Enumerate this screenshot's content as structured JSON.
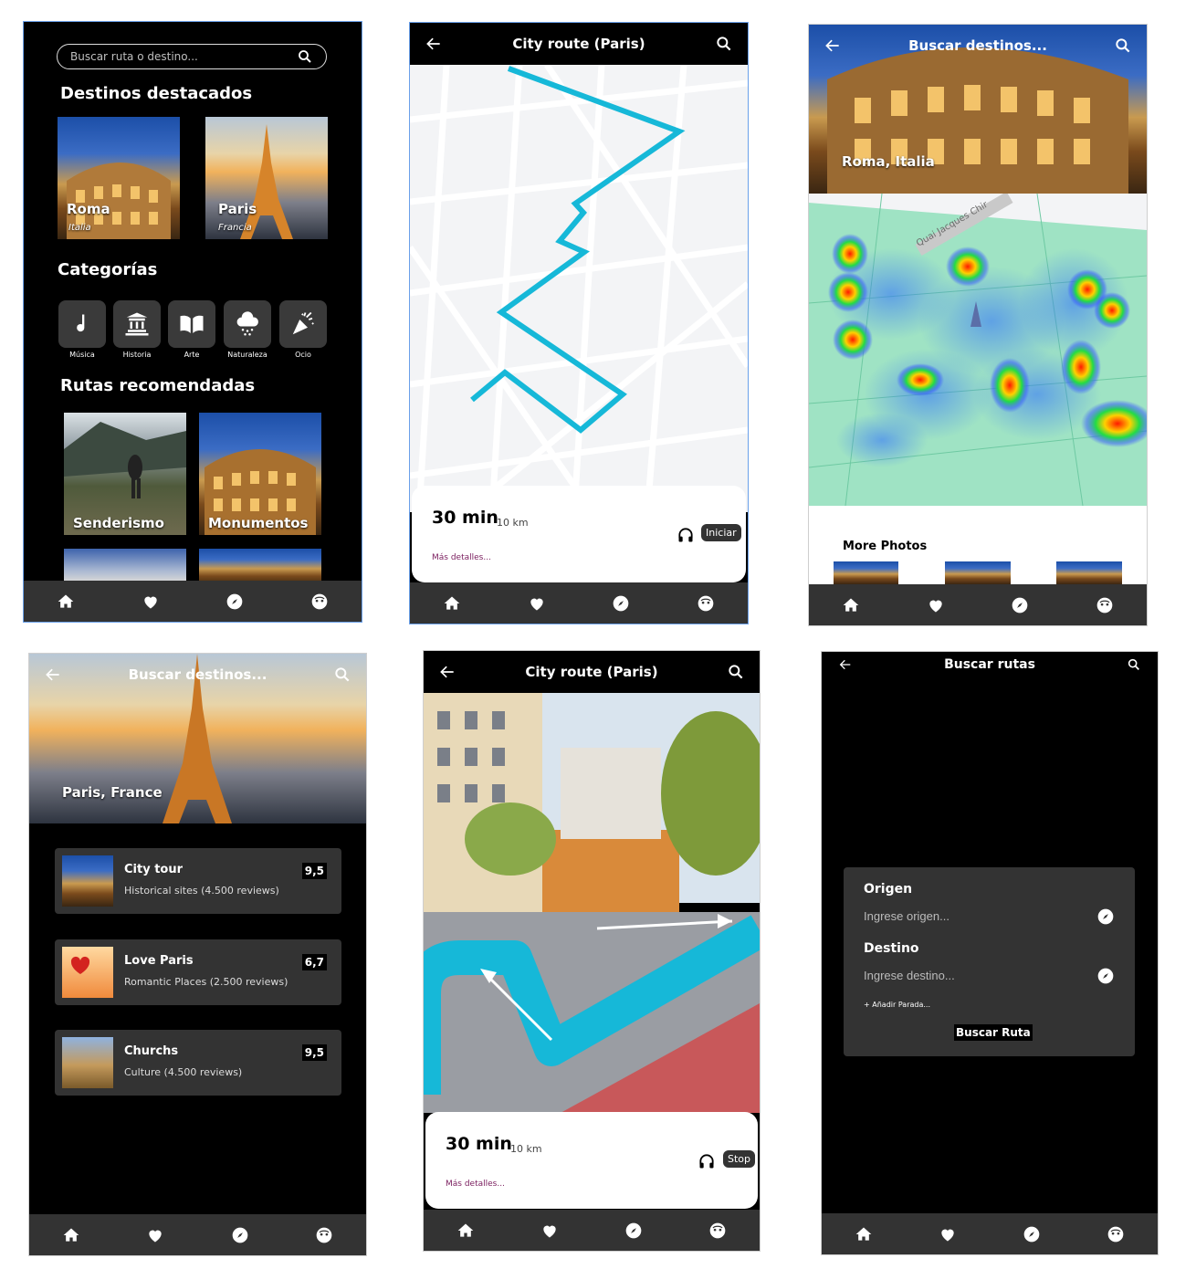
{
  "screen1": {
    "search_placeholder": "Buscar ruta o destino...",
    "featured_heading": "Destinos destacados",
    "featured": [
      {
        "city": "Roma",
        "country": "Italia"
      },
      {
        "city": "Paris",
        "country": "Francia"
      }
    ],
    "categories_heading": "Categorías",
    "categories": [
      {
        "label": "Música",
        "icon": "music-note-icon"
      },
      {
        "label": "Historia",
        "icon": "temple-icon"
      },
      {
        "label": "Arte",
        "icon": "book-icon"
      },
      {
        "label": "Naturaleza",
        "icon": "cloud-snow-icon"
      },
      {
        "label": "Ocio",
        "icon": "party-popper-icon"
      }
    ],
    "routes_heading": "Rutas recomendadas",
    "routes": [
      {
        "label": "Senderismo"
      },
      {
        "label": "Monumentos"
      }
    ]
  },
  "screen2": {
    "title": "City route (Paris)",
    "time": "30 min",
    "distance": "10 km",
    "more_details": "Más detalles...",
    "start_label": "Iniciar"
  },
  "screen3": {
    "search_placeholder": "Buscar destinos...",
    "hero_caption": "Roma, Italia",
    "map_street": "Quai Jacques Chir",
    "more_photos": "More Photos"
  },
  "screen4": {
    "search_placeholder": "Buscar destinos...",
    "hero_caption": "Paris, France",
    "tours": [
      {
        "title": "City tour",
        "subtitle": "Historical sites (4.500 reviews)",
        "score": "9,5"
      },
      {
        "title": "Love Paris",
        "subtitle": "Romantic Places (2.500 reviews)",
        "score": "6,7"
      },
      {
        "title": "Churchs",
        "subtitle": "Culture (4.500 reviews)",
        "score": "9,5"
      }
    ]
  },
  "screen5": {
    "title": "City route (Paris)",
    "time": "30 min",
    "distance": "10 km",
    "more_details": "Más detalles...",
    "stop_label": "Stop"
  },
  "screen6": {
    "title": "Buscar rutas",
    "origin_label": "Origen",
    "origin_placeholder": "Ingrese origen...",
    "destination_label": "Destino",
    "destination_placeholder": "Ingrese destino...",
    "add_stop": "+ Añadir Parada...",
    "search_button": "Buscar Ruta"
  },
  "colors": {
    "route_line": "#16b8d8",
    "card_dark": "#333333",
    "details_link": "#7a1d5e",
    "frame_selected": "#6aa0ea"
  },
  "nav_icons": [
    "home-icon",
    "heart-icon",
    "compass-icon",
    "profile-face-icon"
  ]
}
